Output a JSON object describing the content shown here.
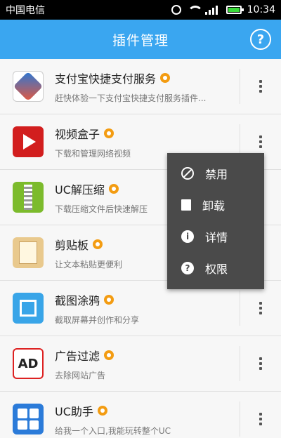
{
  "status_bar": {
    "carrier": "中国电信",
    "time": "10:34"
  },
  "app_bar": {
    "title": "插件管理",
    "help_symbol": "?"
  },
  "plugins": [
    {
      "name": "支付宝快捷支付服务",
      "desc": "赶快体验一下支付宝快捷支付服务插件...",
      "icon": "alipay-icon"
    },
    {
      "name": "视频盒子",
      "desc": "下载和管理网络视频",
      "icon": "video-box-icon"
    },
    {
      "name": "UC解压缩",
      "desc": "下载压缩文件后快速解压",
      "icon": "unzip-icon"
    },
    {
      "name": "剪贴板",
      "desc": "让文本粘贴更便利",
      "icon": "clipboard-icon"
    },
    {
      "name": "截图涂鸦",
      "desc": "截取屏幕并创作和分享",
      "icon": "screenshot-icon"
    },
    {
      "name": "广告过滤",
      "desc": "去除网站广告",
      "icon": "ad-filter-icon"
    },
    {
      "name": "UC助手",
      "desc": "给我一个入口,我能玩转整个UC",
      "icon": "uc-helper-icon"
    }
  ],
  "ad_icon_text": "AD",
  "context_menu": {
    "items": [
      {
        "label": "禁用",
        "icon": "ban-icon"
      },
      {
        "label": "卸载",
        "icon": "trash-icon"
      },
      {
        "label": "详情",
        "icon": "info-icon"
      },
      {
        "label": "权限",
        "icon": "lock-icon"
      }
    ]
  },
  "colors": {
    "accent": "#3aa6f0",
    "menu_bg": "#4a4a4a",
    "badge": "#f39c12"
  }
}
